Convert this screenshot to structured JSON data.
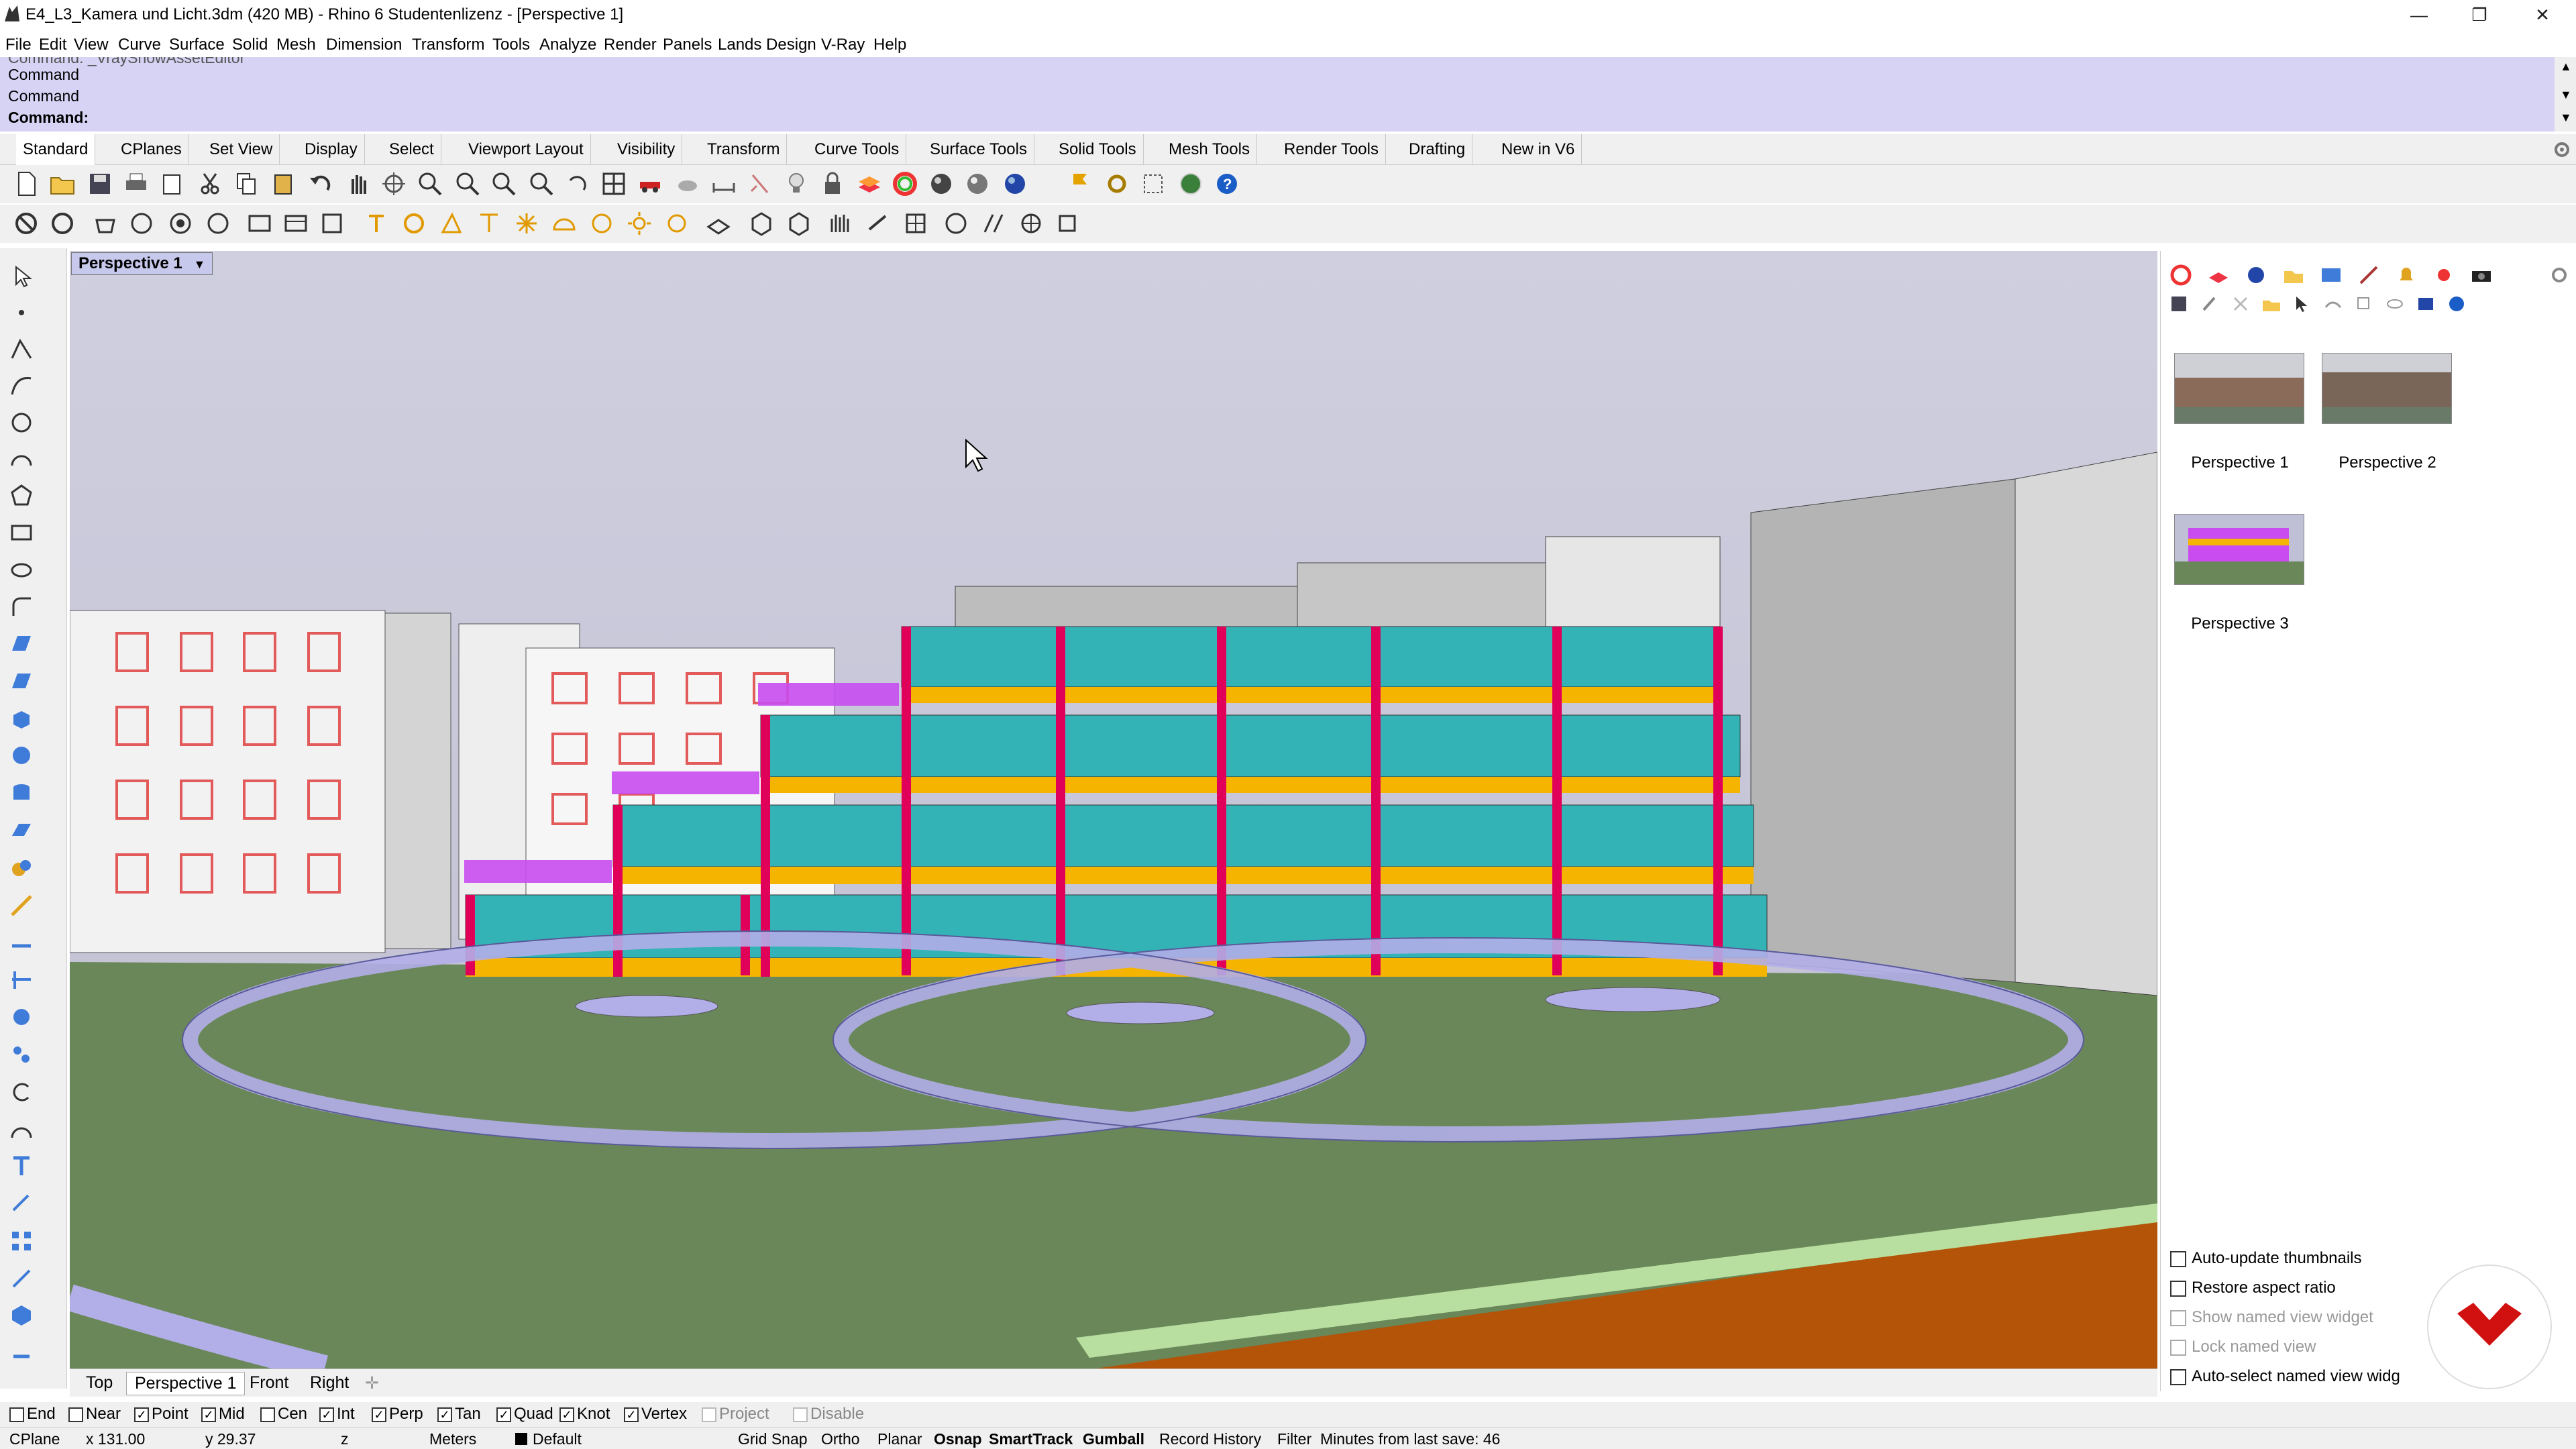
{
  "window": {
    "title": "E4_L3_Kamera und Licht.3dm (420 MB) - Rhino 6 Studentenlizenz - [Perspective 1]",
    "minimize": "—",
    "restore": "❐",
    "close": "✕"
  },
  "menu": [
    "File",
    "Edit",
    "View",
    "Curve",
    "Surface",
    "Solid",
    "Mesh",
    "Dimension",
    "Transform",
    "Tools",
    "Analyze",
    "Render",
    "Panels",
    "Lands Design",
    "V-Ray",
    "Help"
  ],
  "command": {
    "history_partial": "Command: _VrayShowAssetEditor",
    "lines": [
      "Command",
      "Command"
    ],
    "prompt": "Command:"
  },
  "toolbar_tabs": [
    "Standard",
    "CPlanes",
    "Set View",
    "Display",
    "Select",
    "Viewport Layout",
    "Visibility",
    "Transform",
    "Curve Tools",
    "Surface Tools",
    "Solid Tools",
    "Mesh Tools",
    "Render Tools",
    "Drafting",
    "New in V6"
  ],
  "viewport": {
    "label": "Perspective 1"
  },
  "named_views": {
    "thumbnails": [
      "Perspective 1",
      "Perspective 2",
      "Perspective 3"
    ],
    "options": [
      {
        "label": "Auto-update thumbnails",
        "enabled": true
      },
      {
        "label": "Restore aspect ratio",
        "enabled": true
      },
      {
        "label": "Show named view widget",
        "enabled": false
      },
      {
        "label": "Lock named view",
        "enabled": false
      },
      {
        "label": "Auto-select named view widg",
        "enabled": true
      }
    ]
  },
  "view_tabs": [
    "Top",
    "Perspective 1",
    "Front",
    "Right"
  ],
  "view_tabs_add": "✛",
  "osnaps": [
    {
      "label": "End",
      "checked": false
    },
    {
      "label": "Near",
      "checked": false
    },
    {
      "label": "Point",
      "checked": true
    },
    {
      "label": "Mid",
      "checked": true
    },
    {
      "label": "Cen",
      "checked": false
    },
    {
      "label": "Int",
      "checked": true
    },
    {
      "label": "Perp",
      "checked": true
    },
    {
      "label": "Tan",
      "checked": true
    },
    {
      "label": "Quad",
      "checked": true
    },
    {
      "label": "Knot",
      "checked": true
    },
    {
      "label": "Vertex",
      "checked": true
    },
    {
      "label": "Project",
      "checked": false,
      "disabled": true
    },
    {
      "label": "Disable",
      "checked": false,
      "disabled": true
    }
  ],
  "status": {
    "cplane": "CPlane",
    "x": "x 131.00",
    "y": "y 29.37",
    "z": "z",
    "units": "Meters",
    "layer": "Default",
    "grid_snap": "Grid Snap",
    "ortho": "Ortho",
    "planar": "Planar",
    "osnap": "Osnap",
    "smarttrack": "SmartTrack",
    "gumball": "Gumball",
    "record_history": "Record History",
    "filter": "Filter",
    "last_save": "Minutes from last save: 46"
  },
  "colors": {
    "command_bg": "#d6d3f4",
    "ground": "#6a8759",
    "glass": "#33b3b5",
    "balcony": "#f5b400",
    "column": "#e0005a",
    "railing": "#c84cf0",
    "path": "#b2aee8",
    "brand_logo": "#d11010"
  }
}
